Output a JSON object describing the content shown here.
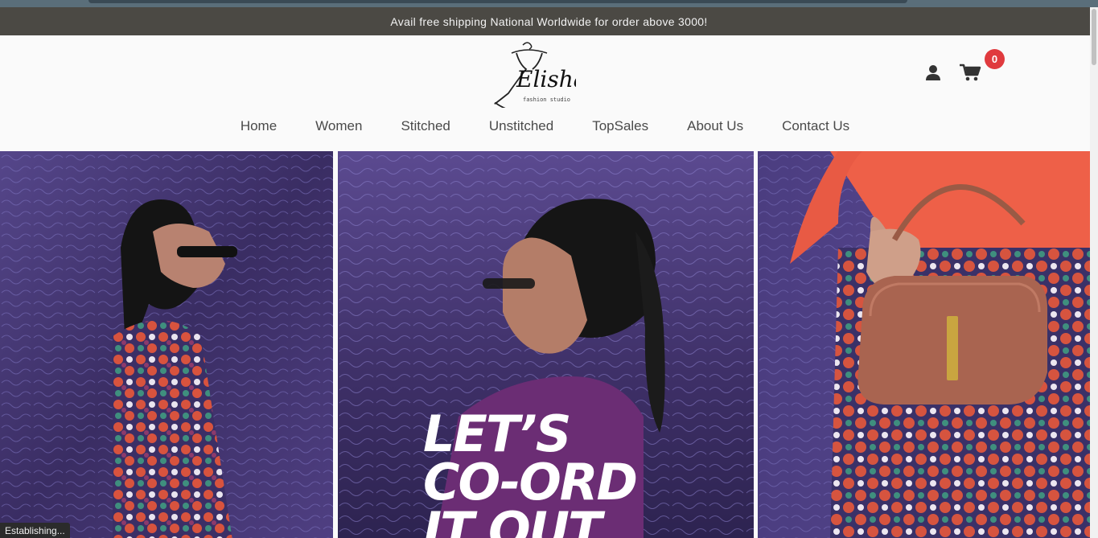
{
  "announcement": "Avail free shipping National Worldwide for order above 3000!",
  "brand": {
    "name": "Elisha",
    "tagline": "fashion studio"
  },
  "header": {
    "user_icon": "user-icon",
    "cart_icon": "cart-icon",
    "cart_count": "0"
  },
  "nav": {
    "items": [
      "Home",
      "Women",
      "Stitched",
      "Unstitched",
      "TopSales",
      "About Us",
      "Contact Us"
    ]
  },
  "hero": {
    "line1": "LET’S",
    "line2": "CO-ORD",
    "line3": "IT OUT"
  },
  "status_bar": "Establishing...",
  "colors": {
    "announcement_bg": "#4b4944",
    "badge": "#e03a3e",
    "hero_bg": "#4a3a78"
  }
}
